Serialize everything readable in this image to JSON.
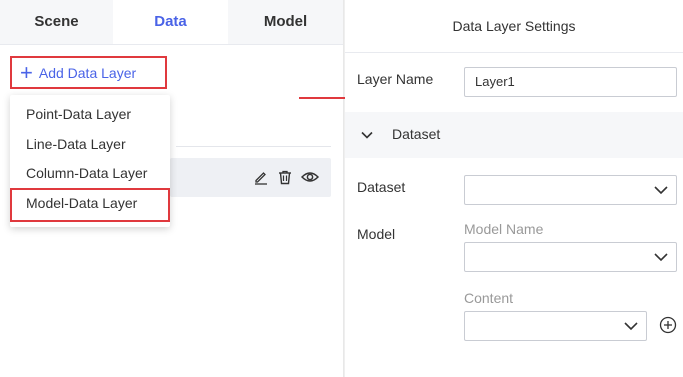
{
  "tabs": {
    "scene": "Scene",
    "data": "Data",
    "model": "Model"
  },
  "add_layer": {
    "label": "Add Data Layer"
  },
  "dropdown": {
    "items": [
      "Point-Data Layer",
      "Line-Data Layer",
      "Column-Data Layer",
      "Model-Data Layer"
    ]
  },
  "settings": {
    "title": "Data Layer Settings",
    "layer_name_label": "Layer Name",
    "layer_name_value": "Layer1",
    "section_label": "Dataset",
    "dataset_label": "Dataset",
    "dataset_value": "",
    "model_label": "Model",
    "model_name_label": "Model Name",
    "model_name_value": "",
    "content_label": "Content",
    "content_value": ""
  },
  "colors": {
    "accent": "#4a63e7",
    "highlight": "#e0393e"
  }
}
